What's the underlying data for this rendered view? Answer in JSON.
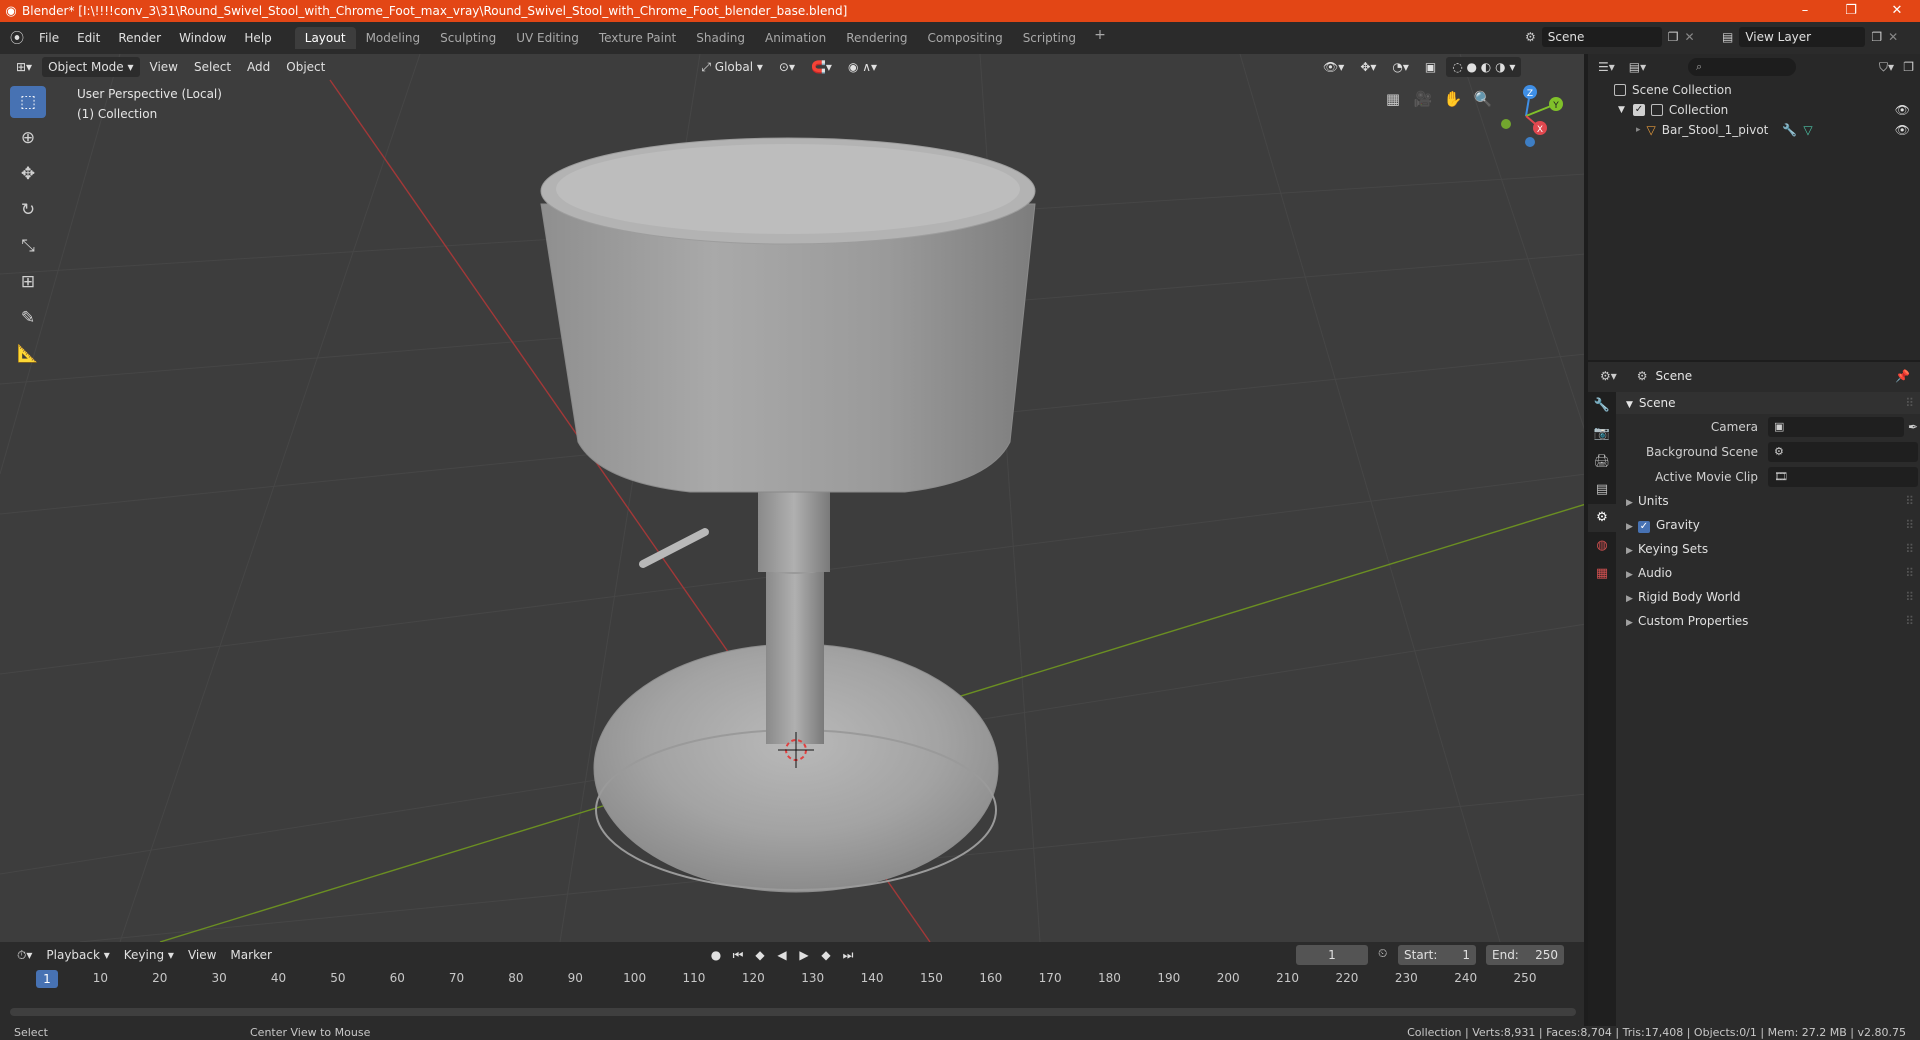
{
  "window": {
    "title": "Blender* [I:\\!!!!conv_3\\31\\Round_Swivel_Stool_with_Chrome_Foot_max_vray\\Round_Swivel_Stool_with_Chrome_Foot_blender_base.blend]",
    "minimize": "–",
    "maximize": "❐",
    "close": "✕"
  },
  "menu": [
    "File",
    "Edit",
    "Render",
    "Window",
    "Help"
  ],
  "workspaces": [
    "Layout",
    "Modeling",
    "Sculpting",
    "UV Editing",
    "Texture Paint",
    "Shading",
    "Animation",
    "Rendering",
    "Compositing",
    "Scripting"
  ],
  "active_workspace": "Layout",
  "scene_name": "Scene",
  "view_layer": "View Layer",
  "viewport": {
    "mode": "Object Mode",
    "menus": [
      "View",
      "Select",
      "Add",
      "Object"
    ],
    "transform_orientation": "Global",
    "perspective_label": "User Perspective (Local)",
    "collection_label": "(1) Collection"
  },
  "axis_gizmo": {
    "x": "X",
    "y": "Y",
    "z": "Z"
  },
  "outliner": {
    "search_placeholder": "",
    "root": "Scene Collection",
    "collection": "Collection",
    "object": "Bar_Stool_1_pivot"
  },
  "properties": {
    "context": "Scene",
    "panel_title": "Scene",
    "camera_label": "Camera",
    "background_scene_label": "Background Scene",
    "active_movie_clip_label": "Active Movie Clip",
    "subpanels": [
      "Units",
      "Gravity",
      "Keying Sets",
      "Audio",
      "Rigid Body World",
      "Custom Properties"
    ],
    "gravity_enabled": true
  },
  "timeline": {
    "menus": [
      "Playback",
      "Keying",
      "View",
      "Marker"
    ],
    "current_frame": "1",
    "start_label": "Start:",
    "start": "1",
    "end_label": "End:",
    "end": "250",
    "ticks": [
      "1",
      "10",
      "20",
      "30",
      "40",
      "50",
      "60",
      "70",
      "80",
      "90",
      "100",
      "110",
      "120",
      "130",
      "140",
      "150",
      "160",
      "170",
      "180",
      "190",
      "200",
      "210",
      "220",
      "230",
      "240",
      "250"
    ]
  },
  "statusbar": {
    "left": "Select",
    "middle": "Center View to Mouse",
    "right": "Collection | Verts:8,931 | Faces:8,704 | Tris:17,408 | Objects:0/1 | Mem: 27.2 MB | v2.80.75"
  },
  "colors": {
    "accent": "#4772b3",
    "titlebar": "#e34615",
    "axis_x": "#e0484f",
    "axis_y": "#80c12a",
    "axis_z": "#3f8fe6"
  }
}
